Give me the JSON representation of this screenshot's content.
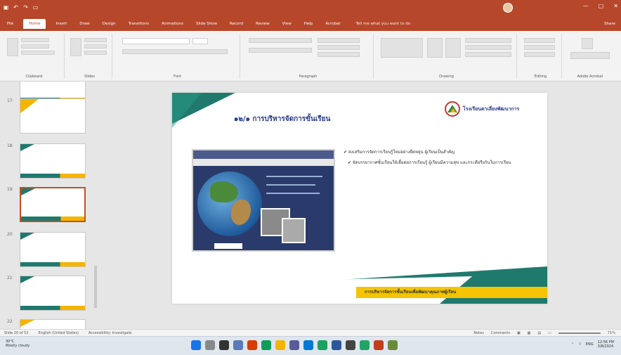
{
  "window": {
    "title": "",
    "account": "",
    "controls": [
      "—",
      "▢",
      "✕"
    ]
  },
  "qat": [
    "save-icon",
    "undo-icon",
    "redo-icon",
    "present-icon"
  ],
  "tabs": [
    "File",
    "Home",
    "Insert",
    "Draw",
    "Design",
    "Transitions",
    "Animations",
    "Slide Show",
    "Record",
    "Review",
    "View",
    "Help",
    "Acrobat",
    "Tell me what you want to do",
    "Share"
  ],
  "ribbon": {
    "groups": [
      "Clipboard",
      "Slides",
      "Font",
      "Paragraph",
      "Drawing",
      "Editing",
      "Adobe Acrobat"
    ]
  },
  "thumbnails": [
    {
      "num": "17"
    },
    {
      "num": "18"
    },
    {
      "num": "19"
    },
    {
      "num": "20"
    },
    {
      "num": "21"
    },
    {
      "num": "22"
    }
  ],
  "slide": {
    "title": "๑๒/๑ การบริหารจัดการขั้นเรียน",
    "org": "โรงเรียนตาเลี่ยงพัฒนาการ",
    "bullet1": "✔ ส่งเสริมการจัดการเรียนรู้ใหม่อย่างยืดหยุ่น ผู้เรียนเป็นสำคัญ",
    "bullet2": "✔ จัดบรรยากาศชั้นเรียนให้เอื้อต่อการเรียนรู้ ผู้เรียนมีความสุข และกระตือรือร้นในการเรียน",
    "band": "การบริหารจัดการชั้นเรียนเพื่อพัฒนาคุณภาพผู้เรียน"
  },
  "status": {
    "slide": "Slide 20 of 52",
    "lang": "English (United States)",
    "access": "Accessibility: Investigate",
    "notes": "Notes",
    "comments": "Comments",
    "zoom": "71%"
  },
  "taskbar": {
    "weather": "30°C",
    "weather2": "Mostly cloudy",
    "lang": "ENG",
    "time": "12:56 PM",
    "date": "3/8/2024"
  }
}
